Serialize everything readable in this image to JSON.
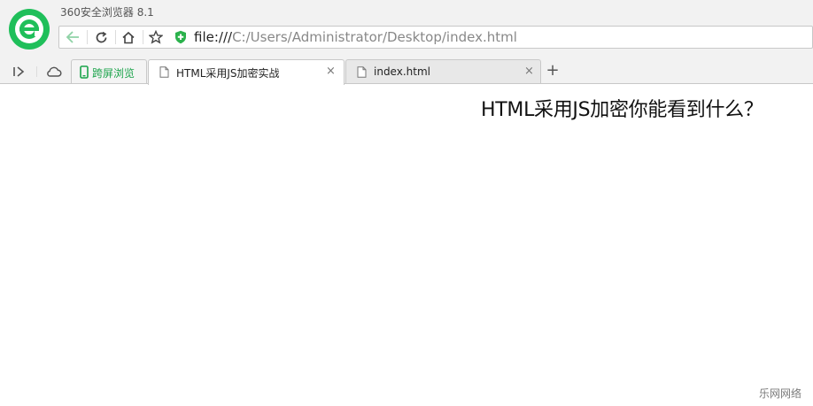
{
  "window": {
    "title": "360安全浏览器 8.1"
  },
  "address_bar": {
    "url_protocol": "file:///",
    "url_path": "C:/Users/Administrator/Desktop/index.html"
  },
  "toolbar": {
    "icons": [
      "back-arrow-icon",
      "refresh-icon",
      "home-icon",
      "star-icon",
      "security-shield-icon"
    ]
  },
  "tabs": [
    {
      "label": "跨屏浏览",
      "color": "#1aa34a"
    },
    {
      "label": "HTML采用JS加密实战",
      "active": true,
      "close": "×"
    },
    {
      "label": "index.html",
      "close": "×"
    }
  ],
  "new_tab": {
    "label": "+"
  },
  "content": {
    "heading": "HTML采用JS加密你能看到什么？"
  },
  "watermark": {
    "text": "乐网网络"
  },
  "colors": {
    "brand_green": "#1fbf5a",
    "cross_screen_green": "#1aa34a",
    "shield_green": "#2bb24c"
  }
}
